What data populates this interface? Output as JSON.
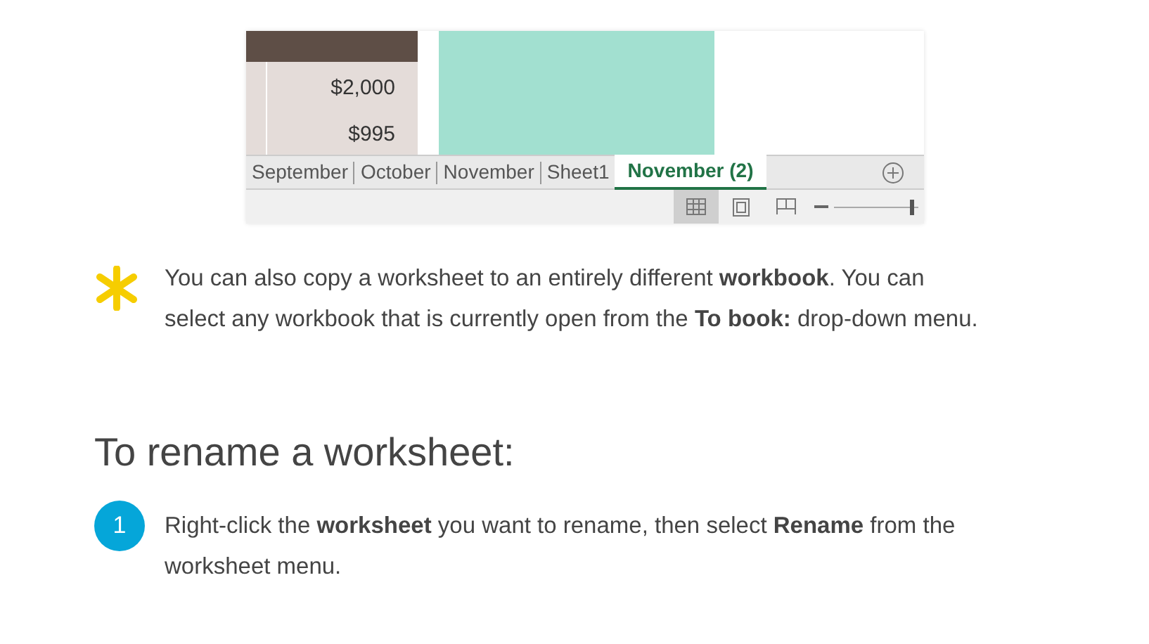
{
  "spreadsheet": {
    "cells": [
      "$2,000",
      "$995"
    ],
    "sheet_tabs": [
      {
        "label": "September",
        "selected": false
      },
      {
        "label": "October",
        "selected": false
      },
      {
        "label": "November",
        "selected": false
      },
      {
        "label": "Sheet1",
        "selected": false
      },
      {
        "label": "November (2)",
        "selected": true
      }
    ],
    "view_buttons": [
      {
        "kind": "normal",
        "selected": true
      },
      {
        "kind": "page-layout",
        "selected": false
      },
      {
        "kind": "page-break",
        "selected": false
      }
    ],
    "zoom": {
      "level": 0.95
    }
  },
  "tip": {
    "text": "You can also copy a worksheet to an entirely different **workbook**. You can select any workbook that is currently open from the **To book:** drop-down menu."
  },
  "heading": "To rename a worksheet:",
  "steps": [
    {
      "number": "1",
      "text": "Right-click the **worksheet** you want to rename, then select **Rename** from the worksheet menu."
    }
  ]
}
